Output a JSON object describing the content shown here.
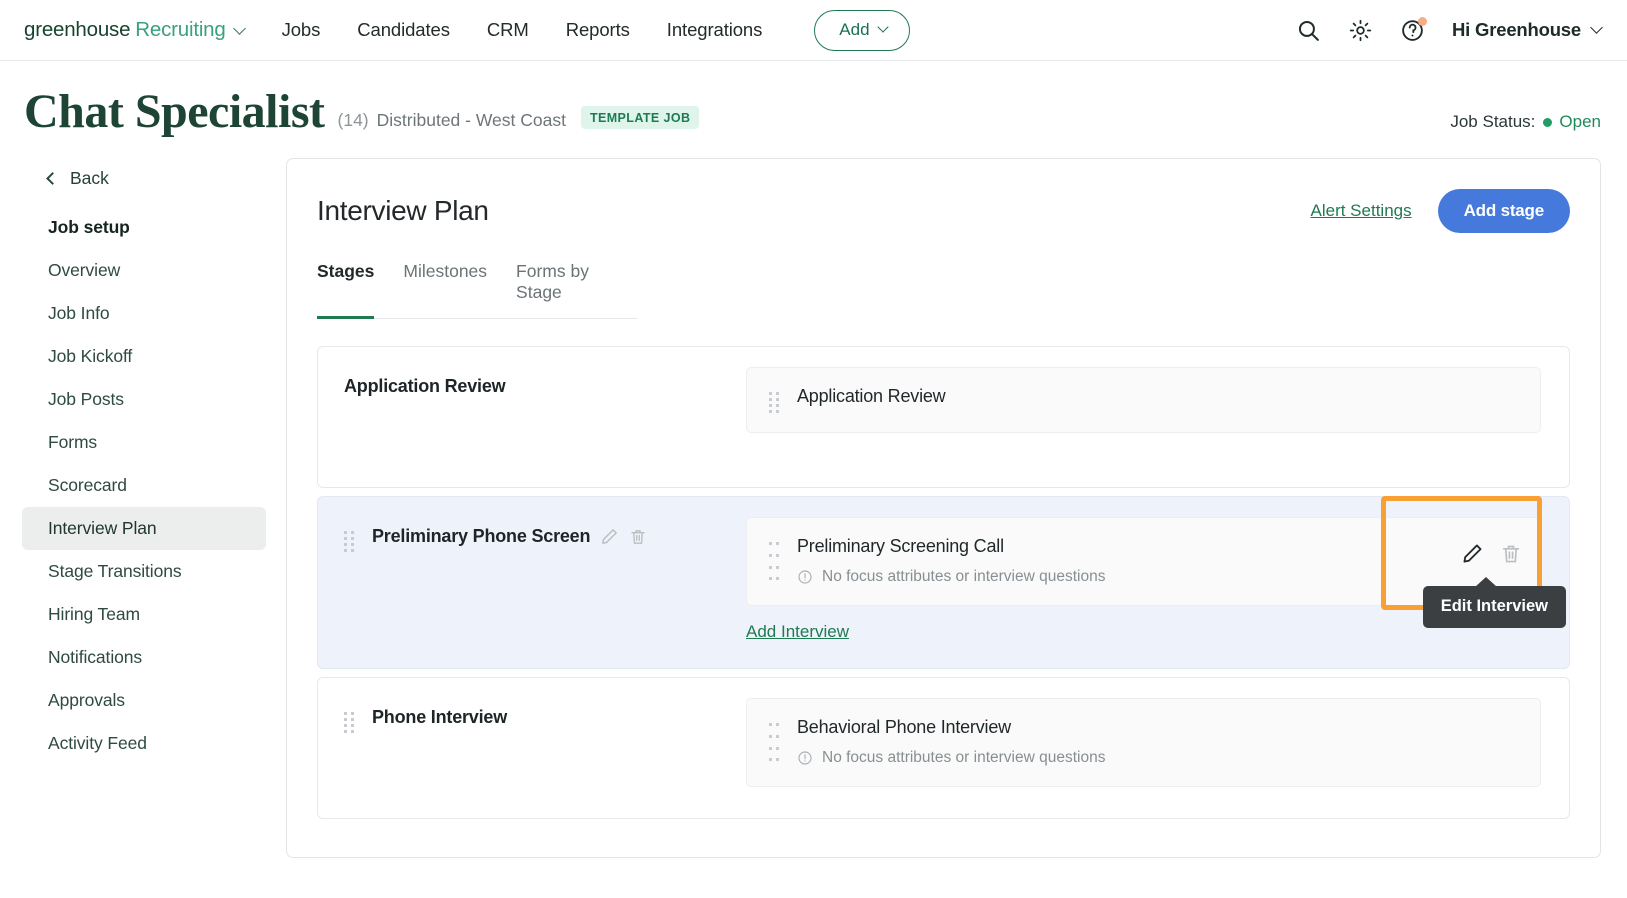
{
  "header": {
    "brand_primary": "greenhouse",
    "brand_secondary": "Recruiting",
    "nav": [
      {
        "label": "Jobs"
      },
      {
        "label": "Candidates"
      },
      {
        "label": "CRM"
      },
      {
        "label": "Reports"
      },
      {
        "label": "Integrations"
      }
    ],
    "add_button": "Add",
    "user_menu": "Hi Greenhouse",
    "icons": [
      "search-icon",
      "gear-icon",
      "help-icon"
    ],
    "accent_green": "#3aa17e",
    "notification_dot_color": "#f6ad8a"
  },
  "page": {
    "title": "Chat Specialist",
    "count": "(14)",
    "location": "Distributed - West Coast",
    "badge": "TEMPLATE JOB",
    "status_label": "Job Status:",
    "status_value": "Open",
    "status_color": "#1f9d63"
  },
  "sidebar": {
    "back_label": "Back",
    "items": [
      {
        "label": "Job setup",
        "kind": "head"
      },
      {
        "label": "Overview",
        "kind": "item"
      },
      {
        "label": "Job Info",
        "kind": "item"
      },
      {
        "label": "Job Kickoff",
        "kind": "item"
      },
      {
        "label": "Job Posts",
        "kind": "item"
      },
      {
        "label": "Forms",
        "kind": "item"
      },
      {
        "label": "Scorecard",
        "kind": "item"
      },
      {
        "label": "Interview Plan",
        "kind": "active"
      },
      {
        "label": "Stage Transitions",
        "kind": "item"
      },
      {
        "label": "Hiring Team",
        "kind": "item"
      },
      {
        "label": "Notifications",
        "kind": "item"
      },
      {
        "label": "Approvals",
        "kind": "item"
      },
      {
        "label": "Activity Feed",
        "kind": "item"
      }
    ]
  },
  "main": {
    "title": "Interview Plan",
    "alert_settings": "Alert Settings",
    "add_stage": "Add stage",
    "add_stage_color": "#4679dc",
    "tabs": [
      {
        "label": "Stages",
        "active": true
      },
      {
        "label": "Milestones",
        "active": false
      },
      {
        "label": "Forms by Stage",
        "active": false
      }
    ],
    "stages": [
      {
        "name": "Application Review",
        "highlighted": false,
        "has_edit_icons": false,
        "interviews": [
          {
            "name": "Application Review",
            "note": ""
          }
        ],
        "add_interview": ""
      },
      {
        "name": "Preliminary Phone Screen",
        "highlighted": true,
        "has_edit_icons": true,
        "interviews": [
          {
            "name": "Preliminary Screening Call",
            "note": "No focus attributes or interview questions"
          }
        ],
        "add_interview": "Add Interview"
      },
      {
        "name": "Phone Interview",
        "highlighted": false,
        "has_edit_icons": false,
        "interviews": [
          {
            "name": "Behavioral Phone Interview",
            "note": "No focus attributes or interview questions"
          }
        ],
        "add_interview": ""
      }
    ],
    "tooltip": {
      "text": "Edit Interview",
      "highlight_color": "#f8a033"
    }
  }
}
